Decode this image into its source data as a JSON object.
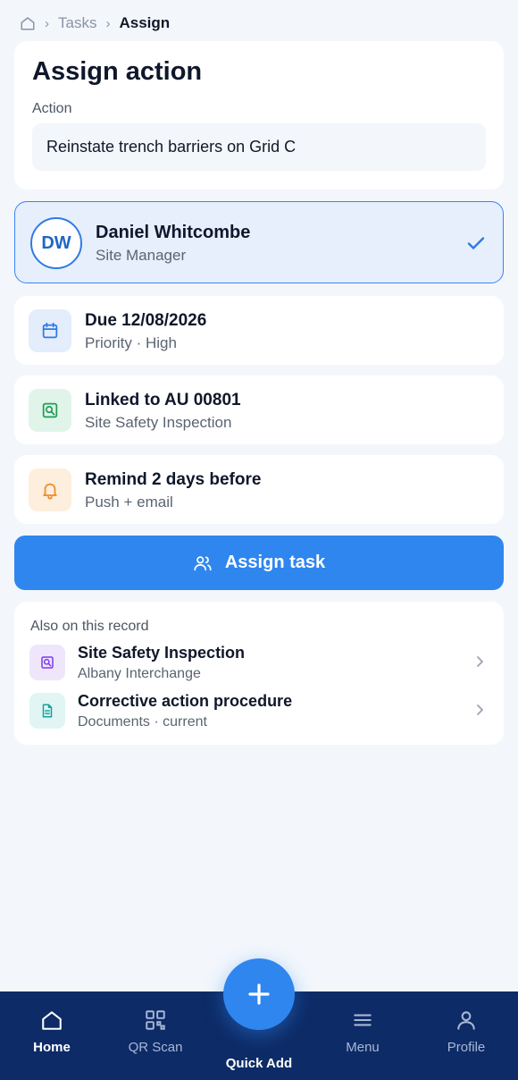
{
  "breadcrumb": {
    "root_icon": "home-icon",
    "items": [
      "Tasks",
      "Assign"
    ]
  },
  "title_card": {
    "title": "Assign action",
    "field_label": "Action",
    "field_value": "Reinstate trench barriers on Grid C"
  },
  "assignee": {
    "initials": "DW",
    "name": "Daniel Whitcombe",
    "role": "Site Manager",
    "selected": true,
    "check_icon": "check-icon"
  },
  "details": [
    {
      "icon": "calendar-icon",
      "title": "Due 12/08/2026",
      "subtitle": "Priority · High",
      "icon_bg": "#e3edfb",
      "icon_color": "#2f7ae5"
    },
    {
      "icon": "inspection-icon",
      "title": "Linked to AU 00801",
      "subtitle": "Site Safety Inspection",
      "icon_bg": "#e0f4ea",
      "icon_color": "#1f9d55"
    },
    {
      "icon": "bell-icon",
      "title": "Remind 2 days before",
      "subtitle": "Push + email",
      "icon_bg": "#fdeedd",
      "icon_color": "#f08a24"
    }
  ],
  "assign_button": {
    "label": "Assign task",
    "icon": "users-icon",
    "color": "#2f86ee"
  },
  "record": {
    "header": "Also on this record",
    "items": [
      {
        "icon": "inspection-icon",
        "title": "Site Safety Inspection",
        "subtitle": "Albany Interchange",
        "icon_bg": "#efe6fb",
        "icon_color": "#7c3aed"
      },
      {
        "icon": "document-icon",
        "title": "Corrective action procedure",
        "subtitle": "Documents · current",
        "icon_bg": "#e0f5f4",
        "icon_color": "#14a3a0"
      }
    ]
  },
  "bottom_nav": {
    "items": [
      {
        "label": "Home",
        "icon": "home-icon",
        "active": true
      },
      {
        "label": "QR Scan",
        "icon": "qr-icon",
        "active": false
      },
      {
        "label": "Menu",
        "icon": "menu-icon",
        "active": false
      },
      {
        "label": "Profile",
        "icon": "profile-icon",
        "active": false
      }
    ],
    "fab": {
      "label": "Quick Add",
      "icon": "plus-icon"
    }
  },
  "colors": {
    "accent": "#2f86ee",
    "nav_bg": "#0d2b66",
    "page_bg": "#f3f7fc"
  }
}
